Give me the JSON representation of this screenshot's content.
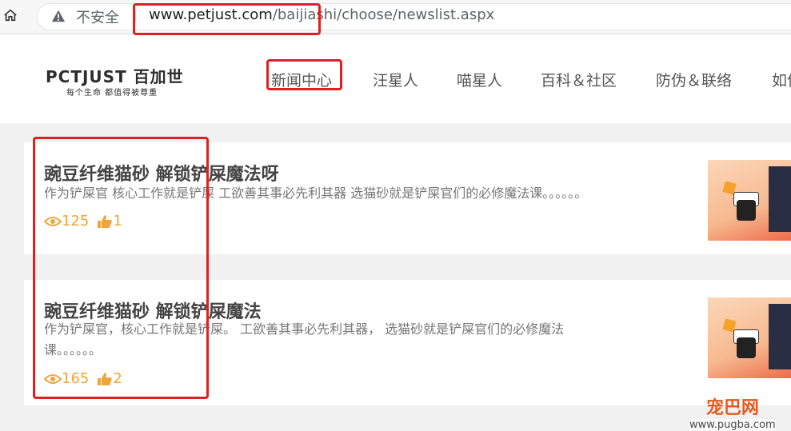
{
  "browser": {
    "security_label": "不安全",
    "separator": "|",
    "url_host": "www.petjust.com",
    "url_path": "/baijiashi/choose/newslist.aspx"
  },
  "logo": {
    "brand_en": "PCTJUST",
    "brand_cn": "百加世",
    "tagline": "每个生命 都值得被尊重"
  },
  "nav": {
    "items": [
      "新闻中心",
      "汪星人",
      "喵星人",
      "百科＆社区",
      "防伪＆联络",
      "如何"
    ]
  },
  "articles": [
    {
      "title": "豌豆纤维猫砂 解锁铲屎魔法呀",
      "desc": "作为铲屎官 核心工作就是铲屎 工欲善其事必先利其器 选猫砂就是铲屎官们的必修魔法课。。。。。。",
      "views": "125",
      "likes": "1"
    },
    {
      "title": "豌豆纤维猫砂 解锁铲屎魔法",
      "desc_line1": "作为铲屎官，核心工作就是铲屎。 工欲善其事必先利其器， 选猫砂就是铲屎官们的必修魔法",
      "desc_line2": "课。。。。。。",
      "views": "165",
      "likes": "2"
    }
  ],
  "watermark": {
    "cn": "宠巴网",
    "en": "www.pugba.com"
  },
  "colors": {
    "accent": "#f0a53c",
    "annotation": "#e02020",
    "watermark": "#e45a1e"
  }
}
